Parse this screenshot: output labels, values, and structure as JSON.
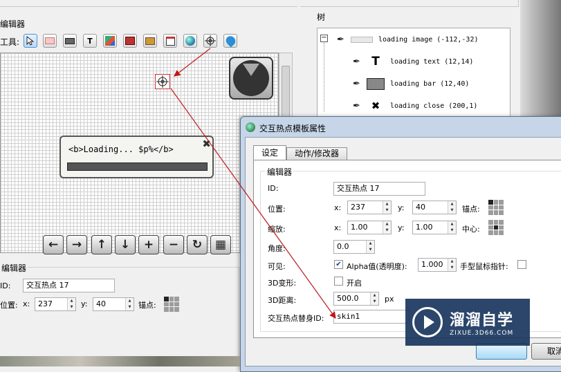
{
  "left_panel": {
    "editor_title": "编辑器",
    "tools_label": "工具:",
    "toolbar_icons": [
      "pointer-icon",
      "image-icon",
      "bar-icon",
      "text-icon",
      "image-map-icon",
      "folder-icon",
      "treasure-icon",
      "calendar-icon",
      "globe-icon",
      "crosshair-icon",
      "balloon-icon"
    ],
    "popup_text": "<b>Loading... $p%</b>",
    "nav_buttons": [
      "←",
      "→",
      "↑",
      "↓",
      "+",
      "−",
      "↻",
      "▦"
    ]
  },
  "bottom_left": {
    "editor_title": "编辑器",
    "id_label": "ID:",
    "id_value": "交互热点 17",
    "pos_label": "位置:",
    "x_label": "x:",
    "x_value": "237",
    "y_label": "y:",
    "y_value": "40",
    "anchor_label": "锚点:"
  },
  "tree": {
    "title": "树",
    "items": [
      {
        "label": "loading image (-112,-32)"
      },
      {
        "label": "loading text (12,14)"
      },
      {
        "label": "loading bar (12,40)"
      },
      {
        "label": "loading close (200,1)"
      }
    ]
  },
  "dialog": {
    "title": "交互热点模板属性",
    "tabs": [
      "设定",
      "动作/修改器"
    ],
    "group_title": "编辑器",
    "id_label": "ID:",
    "id_value": "交互热点 17",
    "pos_label": "位置:",
    "x_label": "x:",
    "x_value": "237",
    "y_label": "y:",
    "y_value": "40",
    "anchor_label": "锚点:",
    "scale_label": "缩放:",
    "scale_x": "1.00",
    "scale_y": "1.00",
    "center_label": "中心:",
    "angle_label": "角度:",
    "angle_value": "0.0",
    "visible_label": "可见:",
    "alpha_label": "Alpha值(透明度):",
    "alpha_value": "1.000",
    "hand_cursor_label": "手型鼠标指针:",
    "transform3d_label": "3D变形:",
    "open_label": "开启",
    "distance3d_label": "3D距离:",
    "distance3d_value": "500.0",
    "px_label": "px",
    "alias_label": "交互热点替身ID:",
    "alias_value": "skin1",
    "cancel_label": "取消"
  },
  "watermark": {
    "brand": "溜溜自学",
    "url": "ZIXUE.3D66.COM"
  }
}
